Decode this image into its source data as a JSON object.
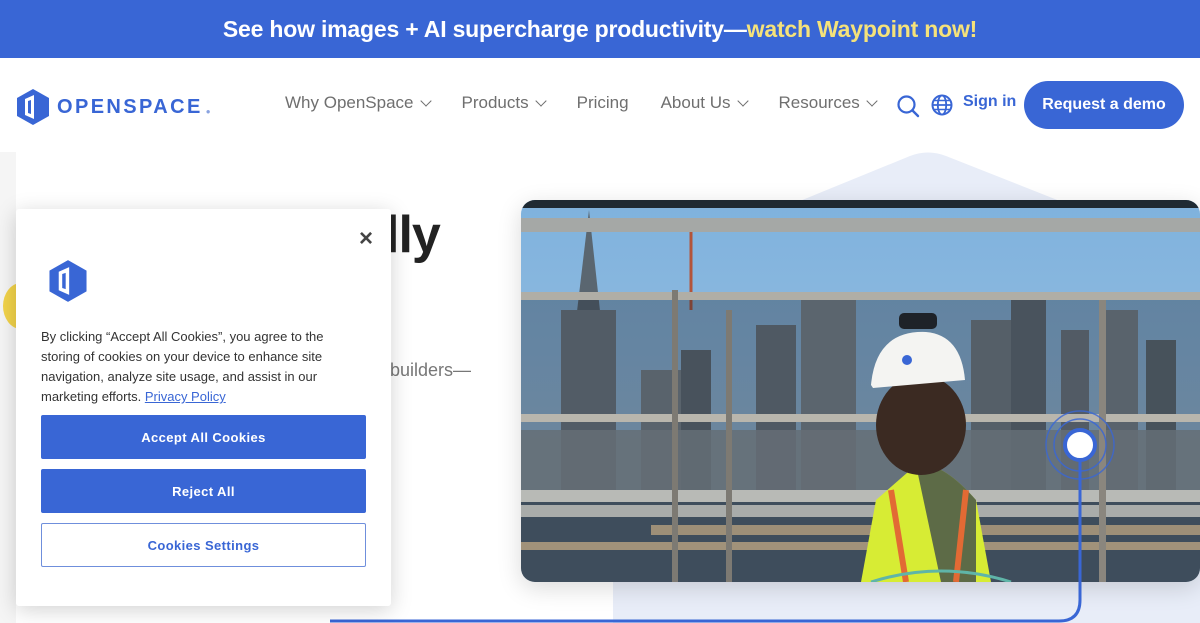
{
  "banner": {
    "text": "See how images + AI supercharge productivity—",
    "highlight": "watch Waypoint now!",
    "bg_color": "#3966d5",
    "highlight_color": "#f5e27a"
  },
  "nav": {
    "logo_text": "OPENSPACE",
    "logo_icon": "openspace-hexagon-icon",
    "items": [
      {
        "label": "Why OpenSpace",
        "has_dropdown": true
      },
      {
        "label": "Products",
        "has_dropdown": true
      },
      {
        "label": "Pricing",
        "has_dropdown": false
      },
      {
        "label": "About Us",
        "has_dropdown": true
      },
      {
        "label": "Resources",
        "has_dropdown": true
      }
    ],
    "search_icon": "search-icon",
    "language_icon": "globe-icon",
    "signin_label": "Sign in",
    "cta_label": "Request a demo",
    "accent_color": "#3966d5"
  },
  "hero": {
    "headline_fragment": "lly",
    "subtext_fragment": "builders—",
    "image_alt": "Construction worker with 360 camera on hard hat walking along scaffolding with San Francisco skyline behind"
  },
  "cookie_modal": {
    "close_label": "×",
    "body_text": "By clicking “Accept All Cookies”, you agree to the storing of cookies on your device to enhance site navigation, analyze site usage, and assist in our marketing efforts.",
    "privacy_link": "Privacy Policy",
    "accept_label": "Accept All Cookies",
    "reject_label": "Reject All",
    "settings_label": "Cookies Settings"
  }
}
